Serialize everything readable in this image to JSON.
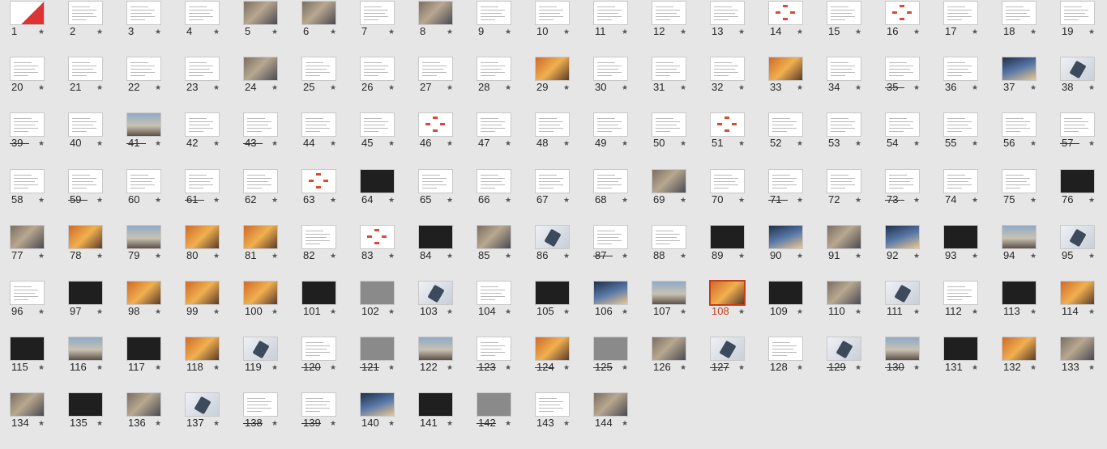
{
  "slide_sorter": {
    "selected_slide": "108",
    "slides": [
      {
        "n": "1",
        "t": "red"
      },
      {
        "n": "2",
        "t": "white"
      },
      {
        "n": "3",
        "t": "white"
      },
      {
        "n": "4",
        "t": "white"
      },
      {
        "n": "5",
        "t": "photo"
      },
      {
        "n": "6",
        "t": "photo"
      },
      {
        "n": "7",
        "t": "white"
      },
      {
        "n": "8",
        "t": "photo"
      },
      {
        "n": "9",
        "t": "white"
      },
      {
        "n": "10",
        "t": "white"
      },
      {
        "n": "11",
        "t": "white"
      },
      {
        "n": "12",
        "t": "white"
      },
      {
        "n": "13",
        "t": "white"
      },
      {
        "n": "14",
        "t": "org"
      },
      {
        "n": "15",
        "t": "white"
      },
      {
        "n": "16",
        "t": "org"
      },
      {
        "n": "17",
        "t": "white"
      },
      {
        "n": "18",
        "t": "white"
      },
      {
        "n": "19",
        "t": "white"
      },
      {
        "n": "20",
        "t": "white"
      },
      {
        "n": "21",
        "t": "white"
      },
      {
        "n": "22",
        "t": "white"
      },
      {
        "n": "23",
        "t": "white"
      },
      {
        "n": "24",
        "t": "photo"
      },
      {
        "n": "25",
        "t": "white"
      },
      {
        "n": "26",
        "t": "white"
      },
      {
        "n": "27",
        "t": "white"
      },
      {
        "n": "28",
        "t": "white"
      },
      {
        "n": "29",
        "t": "photo3"
      },
      {
        "n": "30",
        "t": "white"
      },
      {
        "n": "31",
        "t": "white"
      },
      {
        "n": "32",
        "t": "white"
      },
      {
        "n": "33",
        "t": "photo3"
      },
      {
        "n": "34",
        "t": "white"
      },
      {
        "n": "35",
        "t": "white"
      },
      {
        "n": "36",
        "t": "white"
      },
      {
        "n": "37",
        "t": "photo4"
      },
      {
        "n": "38",
        "t": "phone"
      },
      {
        "n": "39",
        "t": "white"
      },
      {
        "n": "40",
        "t": "white"
      },
      {
        "n": "41",
        "t": "photo2"
      },
      {
        "n": "42",
        "t": "white"
      },
      {
        "n": "43",
        "t": "white"
      },
      {
        "n": "44",
        "t": "white"
      },
      {
        "n": "45",
        "t": "white"
      },
      {
        "n": "46",
        "t": "org"
      },
      {
        "n": "47",
        "t": "white"
      },
      {
        "n": "48",
        "t": "white"
      },
      {
        "n": "49",
        "t": "white"
      },
      {
        "n": "50",
        "t": "white"
      },
      {
        "n": "51",
        "t": "org"
      },
      {
        "n": "52",
        "t": "white"
      },
      {
        "n": "53",
        "t": "white"
      },
      {
        "n": "54",
        "t": "white"
      },
      {
        "n": "55",
        "t": "white"
      },
      {
        "n": "56",
        "t": "white"
      },
      {
        "n": "57",
        "t": "white"
      },
      {
        "n": "58",
        "t": "white"
      },
      {
        "n": "59",
        "t": "white"
      },
      {
        "n": "60",
        "t": "white"
      },
      {
        "n": "61",
        "t": "white"
      },
      {
        "n": "62",
        "t": "white"
      },
      {
        "n": "63",
        "t": "org"
      },
      {
        "n": "64",
        "t": "dark"
      },
      {
        "n": "65",
        "t": "white"
      },
      {
        "n": "66",
        "t": "white"
      },
      {
        "n": "67",
        "t": "white"
      },
      {
        "n": "68",
        "t": "white"
      },
      {
        "n": "69",
        "t": "photo"
      },
      {
        "n": "70",
        "t": "white"
      },
      {
        "n": "71",
        "t": "white"
      },
      {
        "n": "72",
        "t": "white"
      },
      {
        "n": "73",
        "t": "white"
      },
      {
        "n": "74",
        "t": "white"
      },
      {
        "n": "75",
        "t": "white"
      },
      {
        "n": "76",
        "t": "dark"
      },
      {
        "n": "77",
        "t": "photo"
      },
      {
        "n": "78",
        "t": "photo3"
      },
      {
        "n": "79",
        "t": "photo2"
      },
      {
        "n": "80",
        "t": "photo3"
      },
      {
        "n": "81",
        "t": "photo3"
      },
      {
        "n": "82",
        "t": "white"
      },
      {
        "n": "83",
        "t": "org"
      },
      {
        "n": "84",
        "t": "dark"
      },
      {
        "n": "85",
        "t": "photo"
      },
      {
        "n": "86",
        "t": "phone"
      },
      {
        "n": "87",
        "t": "white"
      },
      {
        "n": "88",
        "t": "white"
      },
      {
        "n": "89",
        "t": "dark"
      },
      {
        "n": "90",
        "t": "photo4"
      },
      {
        "n": "91",
        "t": "photo"
      },
      {
        "n": "92",
        "t": "photo4"
      },
      {
        "n": "93",
        "t": "dark"
      },
      {
        "n": "94",
        "t": "photo2"
      },
      {
        "n": "95",
        "t": "phone"
      },
      {
        "n": "96",
        "t": "white"
      },
      {
        "n": "97",
        "t": "dark"
      },
      {
        "n": "98",
        "t": "photo3"
      },
      {
        "n": "99",
        "t": "photo3"
      },
      {
        "n": "100",
        "t": "photo3"
      },
      {
        "n": "101",
        "t": "dark"
      },
      {
        "n": "102",
        "t": "gray"
      },
      {
        "n": "103",
        "t": "phone"
      },
      {
        "n": "104",
        "t": "white"
      },
      {
        "n": "105",
        "t": "dark"
      },
      {
        "n": "106",
        "t": "photo4"
      },
      {
        "n": "107",
        "t": "photo2"
      },
      {
        "n": "108",
        "t": "photo3"
      },
      {
        "n": "109",
        "t": "dark"
      },
      {
        "n": "110",
        "t": "photo"
      },
      {
        "n": "111",
        "t": "phone"
      },
      {
        "n": "112",
        "t": "white"
      },
      {
        "n": "113",
        "t": "dark"
      },
      {
        "n": "114",
        "t": "photo3"
      },
      {
        "n": "115",
        "t": "dark"
      },
      {
        "n": "116",
        "t": "photo2"
      },
      {
        "n": "117",
        "t": "dark"
      },
      {
        "n": "118",
        "t": "photo3"
      },
      {
        "n": "119",
        "t": "phone"
      },
      {
        "n": "120",
        "t": "white"
      },
      {
        "n": "121",
        "t": "gray"
      },
      {
        "n": "122",
        "t": "photo2"
      },
      {
        "n": "123",
        "t": "white"
      },
      {
        "n": "124",
        "t": "photo3"
      },
      {
        "n": "125",
        "t": "gray"
      },
      {
        "n": "126",
        "t": "photo"
      },
      {
        "n": "127",
        "t": "phone"
      },
      {
        "n": "128",
        "t": "white"
      },
      {
        "n": "129",
        "t": "phone"
      },
      {
        "n": "130",
        "t": "photo2"
      },
      {
        "n": "131",
        "t": "dark"
      },
      {
        "n": "132",
        "t": "photo3"
      },
      {
        "n": "133",
        "t": "photo"
      },
      {
        "n": "134",
        "t": "photo"
      },
      {
        "n": "135",
        "t": "dark"
      },
      {
        "n": "136",
        "t": "photo"
      },
      {
        "n": "137",
        "t": "phone"
      },
      {
        "n": "138",
        "t": "white"
      },
      {
        "n": "139",
        "t": "white"
      },
      {
        "n": "140",
        "t": "photo4"
      },
      {
        "n": "141",
        "t": "dark"
      },
      {
        "n": "142",
        "t": "gray"
      },
      {
        "n": "143",
        "t": "white"
      },
      {
        "n": "144",
        "t": "photo"
      }
    ],
    "hidden_slides": [
      "35",
      "39",
      "41",
      "43",
      "57",
      "59",
      "61",
      "71",
      "73",
      "87",
      "120",
      "121",
      "123",
      "124",
      "125",
      "127",
      "129",
      "130",
      "138",
      "139",
      "142"
    ],
    "transition_indicator": "★"
  }
}
